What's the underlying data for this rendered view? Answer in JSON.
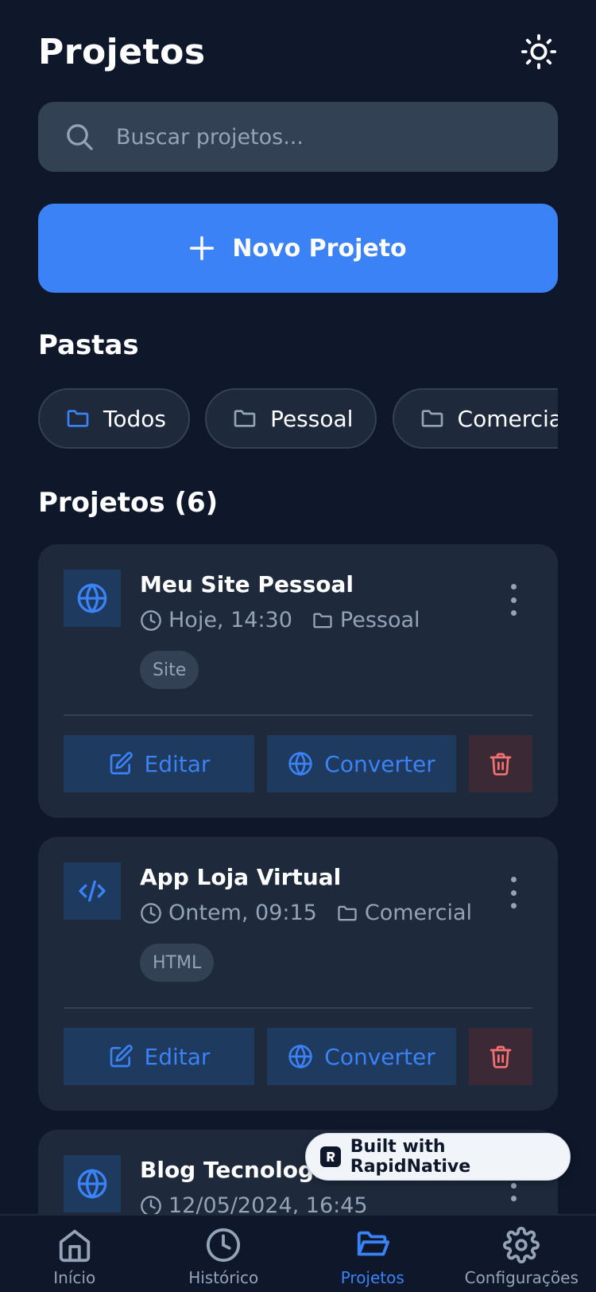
{
  "header": {
    "title": "Projetos",
    "theme_icon": "sun-icon"
  },
  "search": {
    "placeholder": "Buscar projetos...",
    "value": ""
  },
  "new_project_button": {
    "label": "Novo Projeto"
  },
  "folders": {
    "title": "Pastas",
    "items": [
      {
        "label": "Todos",
        "active": true
      },
      {
        "label": "Pessoal",
        "active": false
      },
      {
        "label": "Comercial",
        "active": false
      }
    ]
  },
  "projects": {
    "title": "Projetos (6)",
    "items": [
      {
        "name": "Meu Site Pessoal",
        "date": "Hoje, 14:30",
        "folder": "Pessoal",
        "tag": "Site",
        "icon": "globe-icon",
        "edit_label": "Editar",
        "convert_label": "Converter"
      },
      {
        "name": "App Loja Virtual",
        "date": "Ontem, 09:15",
        "folder": "Comercial",
        "tag": "HTML",
        "icon": "code-icon",
        "edit_label": "Editar",
        "convert_label": "Converter"
      },
      {
        "name": "Blog Tecnologia",
        "date": "12/05/2024, 16:45",
        "icon": "globe-icon"
      }
    ]
  },
  "badge": {
    "label": "Built with RapidNative"
  },
  "bottom_nav": [
    {
      "label": "Início",
      "icon": "home-icon",
      "active": false
    },
    {
      "label": "Histórico",
      "icon": "clock-icon",
      "active": false
    },
    {
      "label": "Projetos",
      "icon": "folder-open-icon",
      "active": true
    },
    {
      "label": "Configurações",
      "icon": "settings-icon",
      "active": false
    }
  ],
  "colors": {
    "background": "#0f172a",
    "card": "#1e293b",
    "accent": "#3b82f6",
    "muted": "#94a3b8",
    "danger": "#f87171"
  }
}
